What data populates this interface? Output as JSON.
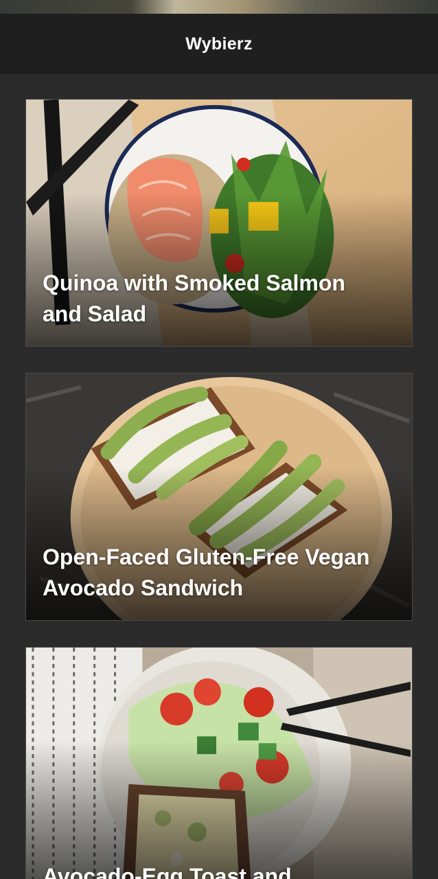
{
  "header": {
    "title": "Wybierz"
  },
  "recipes": [
    {
      "title": "Quinoa with Smoked Salmon and Salad"
    },
    {
      "title": "Open-Faced Gluten-Free Vegan Avocado Sandwich"
    },
    {
      "title": "Avocado-Egg Toast and Vegetable Salad"
    }
  ],
  "colors": {
    "background": "#2b2b2b",
    "header": "#1f1f1f",
    "text": "#ffffff"
  },
  "icons": [
    "quinoa-salmon-photo",
    "avocado-sandwich-photo",
    "egg-toast-salad-photo"
  ]
}
